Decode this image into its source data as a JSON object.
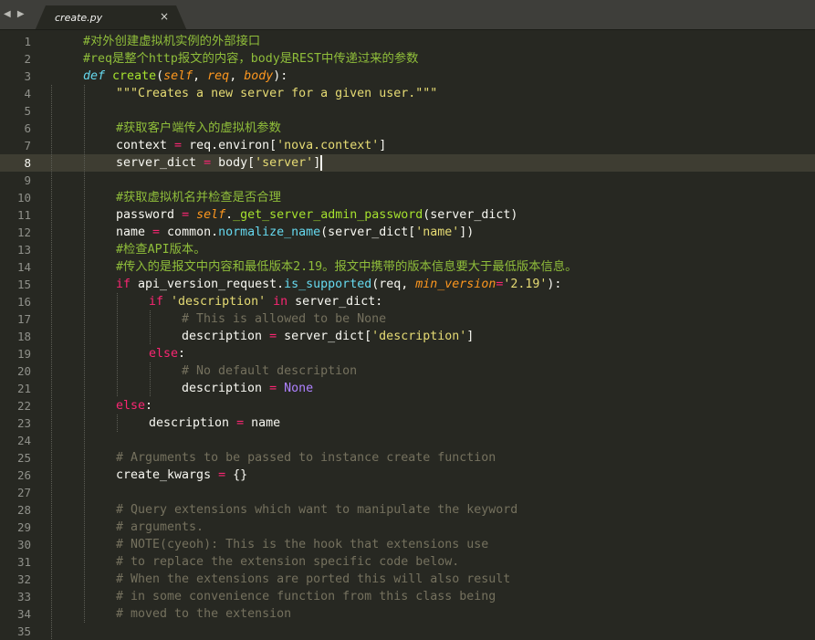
{
  "tab": {
    "title": "create.py",
    "close_label": "×",
    "nav_label": "◀ ▶"
  },
  "current_line": 8,
  "colors": {
    "background": "#272822",
    "tabbar": "#3e3e3a",
    "comment": "#75715e",
    "chinese_comment": "#8fbd3a",
    "keyword": "#f92672",
    "string": "#e6db74",
    "function": "#a6e22e",
    "parameter": "#fd971f",
    "constant": "#ae81ff",
    "definition": "#66d9ef"
  },
  "lines": [
    {
      "n": "1",
      "tokens": [
        [
          "cmz",
          "#对外创建虚拟机实例的外部接口"
        ]
      ]
    },
    {
      "n": "2",
      "tokens": [
        [
          "cmz",
          "#req是整个http报文的内容，body是REST中传递过来的参数"
        ]
      ]
    },
    {
      "n": "3",
      "tokens": [
        [
          "df",
          "def"
        ],
        [
          "tx",
          " "
        ],
        [
          "fn",
          "create"
        ],
        [
          "tx",
          "("
        ],
        [
          "sf",
          "self"
        ],
        [
          "tx",
          ", "
        ],
        [
          "pr",
          "req"
        ],
        [
          "tx",
          ", "
        ],
        [
          "pr",
          "body"
        ],
        [
          "tx",
          "):"
        ]
      ]
    },
    {
      "n": "4",
      "tokens": [
        [
          "st",
          "\"\"\"Creates a new server for a given user.\"\"\""
        ]
      ]
    },
    {
      "n": "5",
      "tokens": []
    },
    {
      "n": "6",
      "tokens": [
        [
          "cmz",
          "#获取客户端传入的虚拟机参数"
        ]
      ]
    },
    {
      "n": "7",
      "tokens": [
        [
          "tx",
          "context "
        ],
        [
          "op",
          "="
        ],
        [
          "tx",
          " req.environ["
        ],
        [
          "st",
          "'nova.context'"
        ],
        [
          "tx",
          "]"
        ]
      ]
    },
    {
      "n": "8",
      "tokens": [
        [
          "tx",
          "server_dict "
        ],
        [
          "op",
          "="
        ],
        [
          "tx",
          " body["
        ],
        [
          "st",
          "'server'"
        ],
        [
          "tx",
          "]"
        ]
      ]
    },
    {
      "n": "9",
      "tokens": []
    },
    {
      "n": "10",
      "tokens": [
        [
          "cmz",
          "#获取虚拟机名并检查是否合理"
        ]
      ]
    },
    {
      "n": "11",
      "tokens": [
        [
          "tx",
          "password "
        ],
        [
          "op",
          "="
        ],
        [
          "tx",
          " "
        ],
        [
          "sf",
          "self"
        ],
        [
          "tx",
          "."
        ],
        [
          "fn",
          "_get_server_admin_password"
        ],
        [
          "tx",
          "(server_dict)"
        ]
      ]
    },
    {
      "n": "12",
      "tokens": [
        [
          "tx",
          "name "
        ],
        [
          "op",
          "="
        ],
        [
          "tx",
          " common."
        ],
        [
          "bi",
          "normalize_name"
        ],
        [
          "tx",
          "(server_dict["
        ],
        [
          "st",
          "'name'"
        ],
        [
          "tx",
          "])"
        ]
      ]
    },
    {
      "n": "13",
      "tokens": [
        [
          "cmz",
          "#检查API版本。"
        ]
      ]
    },
    {
      "n": "14",
      "tokens": [
        [
          "cmz",
          "#传入的是报文中内容和最低版本2.19。报文中携带的版本信息要大于最低版本信息。"
        ]
      ]
    },
    {
      "n": "15",
      "tokens": [
        [
          "kw",
          "if"
        ],
        [
          "tx",
          " api_version_request."
        ],
        [
          "bi",
          "is_supported"
        ],
        [
          "tx",
          "(req, "
        ],
        [
          "pr",
          "min_version"
        ],
        [
          "op",
          "="
        ],
        [
          "st",
          "'2.19'"
        ],
        [
          "tx",
          "):"
        ]
      ]
    },
    {
      "n": "16",
      "tokens": [
        [
          "kw",
          "if"
        ],
        [
          "tx",
          " "
        ],
        [
          "st",
          "'description'"
        ],
        [
          "tx",
          " "
        ],
        [
          "kw",
          "in"
        ],
        [
          "tx",
          " server_dict:"
        ]
      ]
    },
    {
      "n": "17",
      "tokens": [
        [
          "cm",
          "# This is allowed to be None"
        ]
      ]
    },
    {
      "n": "18",
      "tokens": [
        [
          "tx",
          "description "
        ],
        [
          "op",
          "="
        ],
        [
          "tx",
          " server_dict["
        ],
        [
          "st",
          "'description'"
        ],
        [
          "tx",
          "]"
        ]
      ]
    },
    {
      "n": "19",
      "tokens": [
        [
          "kw",
          "else"
        ],
        [
          "tx",
          ":"
        ]
      ]
    },
    {
      "n": "20",
      "tokens": [
        [
          "cm",
          "# No default description"
        ]
      ]
    },
    {
      "n": "21",
      "tokens": [
        [
          "tx",
          "description "
        ],
        [
          "op",
          "="
        ],
        [
          "tx",
          " "
        ],
        [
          "cn",
          "None"
        ]
      ]
    },
    {
      "n": "22",
      "tokens": [
        [
          "kw",
          "else"
        ],
        [
          "tx",
          ":"
        ]
      ]
    },
    {
      "n": "23",
      "tokens": [
        [
          "tx",
          "description "
        ],
        [
          "op",
          "="
        ],
        [
          "tx",
          " name"
        ]
      ]
    },
    {
      "n": "24",
      "tokens": []
    },
    {
      "n": "25",
      "tokens": [
        [
          "cm",
          "# Arguments to be passed to instance create function"
        ]
      ]
    },
    {
      "n": "26",
      "tokens": [
        [
          "tx",
          "create_kwargs "
        ],
        [
          "op",
          "="
        ],
        [
          "tx",
          " {}"
        ]
      ]
    },
    {
      "n": "27",
      "tokens": []
    },
    {
      "n": "28",
      "tokens": [
        [
          "cm",
          "# Query extensions which want to manipulate the keyword"
        ]
      ]
    },
    {
      "n": "29",
      "tokens": [
        [
          "cm",
          "# arguments."
        ]
      ]
    },
    {
      "n": "30",
      "tokens": [
        [
          "cm",
          "# NOTE(cyeoh): This is the hook that extensions use"
        ]
      ]
    },
    {
      "n": "31",
      "tokens": [
        [
          "cm",
          "# to replace the extension specific code below."
        ]
      ]
    },
    {
      "n": "32",
      "tokens": [
        [
          "cm",
          "# When the extensions are ported this will also result"
        ]
      ]
    },
    {
      "n": "33",
      "tokens": [
        [
          "cm",
          "# in some convenience function from this class being"
        ]
      ]
    },
    {
      "n": "34",
      "tokens": [
        [
          "cm",
          "# moved to the extension"
        ]
      ]
    },
    {
      "n": "35",
      "tokens": []
    }
  ]
}
